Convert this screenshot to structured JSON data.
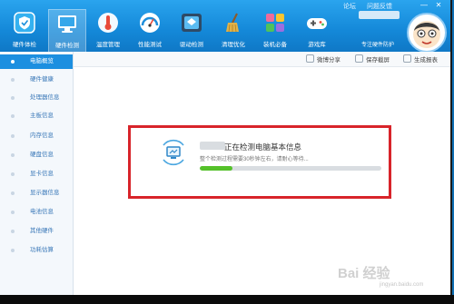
{
  "topbar": {
    "forum": "论坛",
    "feedback": "问题反馈",
    "min": "—",
    "close": "✕"
  },
  "nav": [
    {
      "label": "硬件体检",
      "icon": "shield-check-icon"
    },
    {
      "label": "硬件检测",
      "icon": "pc-monitor-icon",
      "active": true
    },
    {
      "label": "温度管理",
      "icon": "thermometer-icon"
    },
    {
      "label": "性能测试",
      "icon": "speedometer-icon"
    },
    {
      "label": "驱动检测",
      "icon": "driver-box-icon"
    },
    {
      "label": "清理优化",
      "icon": "broom-icon"
    },
    {
      "label": "装机必备",
      "icon": "app-grid-icon"
    },
    {
      "label": "游戏库",
      "icon": "gamepad-icon"
    }
  ],
  "brand": {
    "subtitle": "专注硬件防护",
    "avatar_icon": "mascot-avatar-icon"
  },
  "sidebar": [
    {
      "label": "电脑概览",
      "active": true
    },
    {
      "label": "硬件健康"
    },
    {
      "label": "处理器信息"
    },
    {
      "label": "主板信息"
    },
    {
      "label": "内存信息"
    },
    {
      "label": "硬盘信息"
    },
    {
      "label": "显卡信息"
    },
    {
      "label": "显示器信息"
    },
    {
      "label": "电池信息"
    },
    {
      "label": "其他硬件"
    },
    {
      "label": "功耗估算"
    }
  ],
  "toolbar": {
    "share": "微博分享",
    "save": "保存截屏",
    "report": "生成报表"
  },
  "status": {
    "title": "正在检测电脑基本信息",
    "subtitle": "整个检测过程需要30秒钟左右，请耐心等待...",
    "progress": 0.18
  },
  "colors": {
    "accent": "#1c8fe0",
    "highlight_box": "#d8242a",
    "progress": "#55c12a"
  },
  "watermark": {
    "text": "Bai 经验",
    "sub": "jingyan.baidu.com"
  }
}
